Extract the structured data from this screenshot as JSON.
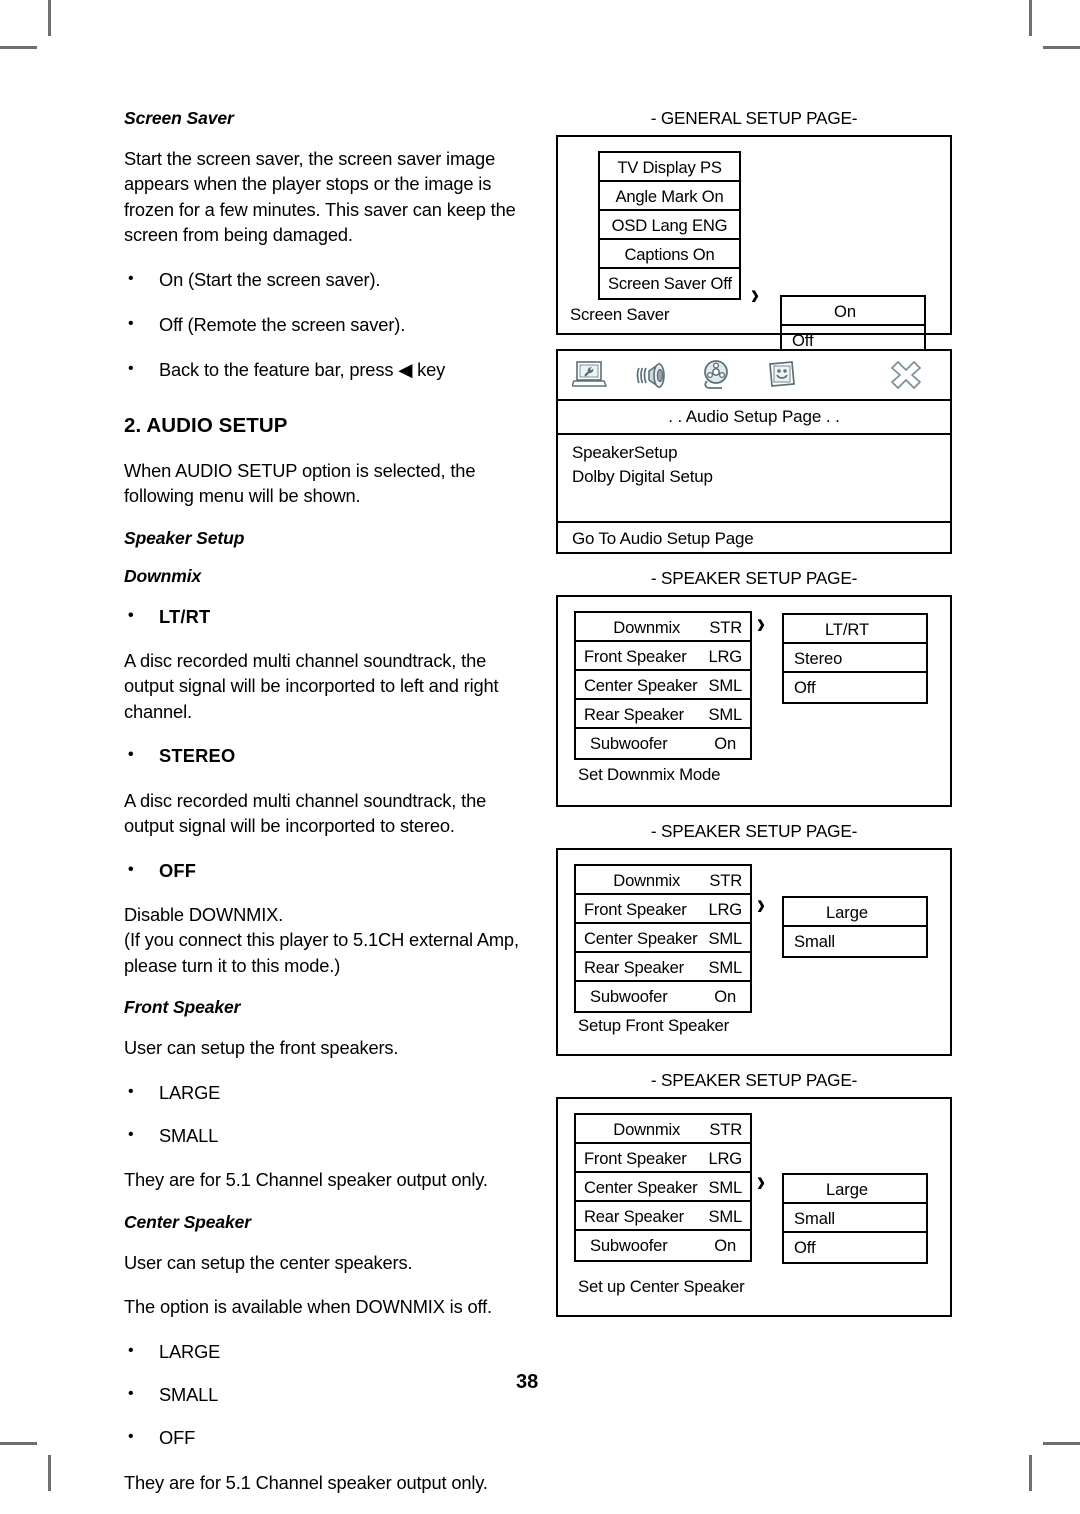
{
  "page_number": "38",
  "left_column": {
    "screen_saver": {
      "heading": "Screen Saver",
      "paragraph": "Start the screen saver, the screen saver image appears when the player stops or the image is frozen for a few minutes. This saver can keep the screen from being damaged.",
      "bullets": [
        "On (Start the screen saver).",
        "Off (Remote the screen saver).",
        "Back to the feature bar, press ◀ key"
      ]
    },
    "audio_setup": {
      "heading": "2. AUDIO SETUP",
      "intro": "When AUDIO SETUP option is selected, the following menu will be shown.",
      "speaker_setup_heading": "Speaker Setup",
      "downmix_heading": "Downmix",
      "ltrt_bullet": "LT/RT",
      "ltrt_text": "A disc recorded multi channel soundtrack, the output signal will be incorported to left and right channel.",
      "stereo_bullet": "STEREO",
      "stereo_text": "A disc recorded multi channel soundtrack, the output signal will be incorported to stereo.",
      "off_bullet": "OFF",
      "off_text_line1": "Disable DOWNMIX.",
      "off_text_line2": "(If you connect this player to 5.1CH external Amp, please turn it to this mode.)",
      "front_speaker_heading": "Front Speaker",
      "front_speaker_text": "User can setup the front speakers.",
      "front_speaker_bullets": [
        "LARGE",
        "SMALL"
      ],
      "front_speaker_note": "They are for 5.1 Channel speaker output only.",
      "center_speaker_heading": "Center Speaker",
      "center_speaker_text": "User can setup the center speakers.",
      "center_speaker_note1": "The option is available when DOWNMIX is off.",
      "center_speaker_bullets": [
        "LARGE",
        "SMALL",
        "OFF"
      ],
      "center_speaker_note2": "They are for 5.1 Channel speaker output only."
    }
  },
  "diagrams": {
    "general_setup": {
      "title": "- GENERAL SETUP PAGE-",
      "menu_items": [
        "TV Display PS",
        "Angle Mark On",
        "OSD Lang ENG",
        "Captions On",
        "Screen Saver Off"
      ],
      "popup_options": [
        "On",
        "Off"
      ],
      "caption": "Screen Saver",
      "chevron": "›"
    },
    "audio_setup_page": {
      "icons": [
        "general-setup-icon",
        "audio-setup-icon",
        "video-setup-icon",
        "preference-setup-icon",
        "exit-setup-icon"
      ],
      "page_title": ". .  Audio Setup Page . .",
      "options": [
        "SpeakerSetup",
        "Dolby Digital Setup"
      ],
      "goto_label": "Go To  Audio Setup Page"
    },
    "speaker_downmix": {
      "title": "- SPEAKER SETUP PAGE-",
      "menu_rows": [
        {
          "label": "Downmix",
          "value": "STR"
        },
        {
          "label": "Front Speaker",
          "value": "LRG"
        },
        {
          "label": "Center Speaker",
          "value": "SML"
        },
        {
          "label": "Rear Speaker",
          "value": "SML"
        },
        {
          "label": "Subwoofer",
          "value": "On"
        }
      ],
      "popup_options": [
        "LT/RT",
        "Stereo",
        "Off"
      ],
      "caption": "Set Downmix Mode",
      "chevron": "›"
    },
    "speaker_front": {
      "title": "- SPEAKER SETUP PAGE-",
      "menu_rows": [
        {
          "label": "Downmix",
          "value": "STR"
        },
        {
          "label": "Front Speaker",
          "value": "LRG"
        },
        {
          "label": "Center Speaker",
          "value": "SML"
        },
        {
          "label": "Rear Speaker",
          "value": "SML"
        },
        {
          "label": "Subwoofer",
          "value": "On"
        }
      ],
      "popup_options": [
        "Large",
        "Small"
      ],
      "caption": "Setup  Front Speaker",
      "chevron": "›"
    },
    "speaker_center": {
      "title": "- SPEAKER SETUP PAGE-",
      "menu_rows": [
        {
          "label": "Downmix",
          "value": "STR"
        },
        {
          "label": "Front Speaker",
          "value": "LRG"
        },
        {
          "label": "Center Speaker",
          "value": "SML"
        },
        {
          "label": "Rear Speaker",
          "value": "SML"
        },
        {
          "label": "Subwoofer",
          "value": "On"
        }
      ],
      "popup_options": [
        "Large",
        "Small",
        "Off"
      ],
      "caption": "Set up Center Speaker",
      "chevron": "›"
    }
  }
}
